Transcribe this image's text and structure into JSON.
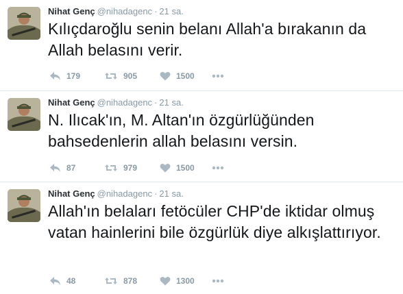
{
  "tweets": [
    {
      "name": "Nihat Genç",
      "handle": "@nihadagenc",
      "separator": "·",
      "time": "21 sa.",
      "text": "Kılıçdaroğlu senin belanı Allah'a bırakanın da Allah belasını verir.",
      "replies": "179",
      "retweets": "905",
      "likes": "1500"
    },
    {
      "name": "Nihat Genç",
      "handle": "@nihadagenc",
      "separator": "·",
      "time": "21 sa.",
      "text": "N. Ilıcak'ın, M. Altan'ın özgürlüğünden bahsedenlerin allah belasını versin.",
      "replies": "87",
      "retweets": "979",
      "likes": "1500"
    },
    {
      "name": "Nihat Genç",
      "handle": "@nihadagenc",
      "separator": "·",
      "time": "21 sa.",
      "text": "Allah'ın belaları fetöcüler CHP'de iktidar olmuş vatan hainlerini bile özgürlük diye alkışlattırıyor.",
      "replies": "48",
      "retweets": "878",
      "likes": "1300"
    }
  ],
  "colors": {
    "text": "#14171a",
    "meta": "#8899a6",
    "divider": "#e1e8ed"
  }
}
